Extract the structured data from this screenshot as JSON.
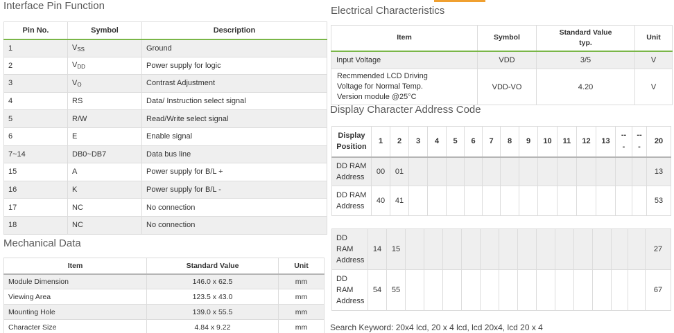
{
  "pin": {
    "title": "Interface Pin Function",
    "headers": [
      "Pin No.",
      "Symbol",
      "Description"
    ],
    "rows": [
      {
        "no": "1",
        "sym": "V",
        "sub": "SS",
        "desc": "Ground"
      },
      {
        "no": "2",
        "sym": "V",
        "sub": "DD",
        "desc": "Power supply for logic"
      },
      {
        "no": "3",
        "sym": "V",
        "sub": "O",
        "desc": "Contrast Adjustment"
      },
      {
        "no": "4",
        "sym": "RS",
        "sub": "",
        "desc": "Data/ Instruction  select signal"
      },
      {
        "no": "5",
        "sym": "R/W",
        "sub": "",
        "desc": "Read/Write select signal"
      },
      {
        "no": "6",
        "sym": "E",
        "sub": "",
        "desc": "Enable signal"
      },
      {
        "no": "7~14",
        "sym": "DB0~DB7",
        "sub": "",
        "desc": "Data bus line"
      },
      {
        "no": "15",
        "sym": "A",
        "sub": "",
        "desc": "Power supply for B/L +"
      },
      {
        "no": "16",
        "sym": "K",
        "sub": "",
        "desc": "Power supply for B/L -"
      },
      {
        "no": "17",
        "sym": "NC",
        "sub": "",
        "desc": "No connection"
      },
      {
        "no": "18",
        "sym": "NC",
        "sub": "",
        "desc": "No connection"
      }
    ]
  },
  "mech": {
    "title": "Mechanical Data",
    "headers": [
      "Item",
      "Standard Value",
      "Unit"
    ],
    "rows": [
      {
        "item": "Module Dimension",
        "value": "146.0 x 62.5",
        "unit": "mm"
      },
      {
        "item": "Viewing Area",
        "value": "123.5 x 43.0",
        "unit": "mm"
      },
      {
        "item": "Mounting Hole",
        "value": "139.0 x 55.5",
        "unit": "mm"
      },
      {
        "item": "Character Size",
        "value": "4.84 x 9.22",
        "unit": "mm"
      }
    ]
  },
  "elec": {
    "title": "Electrical Characteristics",
    "headers": {
      "item": "Item",
      "symbol": "Symbol",
      "std1": "Standard Value",
      "std2": "typ.",
      "unit": "Unit"
    },
    "rows": [
      {
        "item": [
          "Input Voltage"
        ],
        "symbol": "VDD",
        "value": "3/5",
        "unit": "V"
      },
      {
        "item": [
          "Recmmended LCD Driving",
          "Voltage for Normal Temp.",
          "Version module @25°C"
        ],
        "symbol": "VDD-VO",
        "value": "4.20",
        "unit": "V"
      }
    ]
  },
  "addr": {
    "title": "Display Character Address Code",
    "header_first": [
      "Display",
      "Position"
    ],
    "columns": [
      "1",
      "2",
      "3",
      "4",
      "5",
      "6",
      "7",
      "8",
      "9",
      "10",
      "11",
      "12",
      "13",
      "--\n-",
      "--\n-",
      "20"
    ],
    "rows1": [
      {
        "label": [
          "DD RAM",
          "Address"
        ],
        "c1": "00",
        "c2": "01",
        "last": "13"
      },
      {
        "label": [
          "DD RAM",
          "Address"
        ],
        "c1": "40",
        "c2": "41",
        "last": "53"
      }
    ],
    "rows2": [
      {
        "label": [
          "DD",
          "RAM",
          "Address"
        ],
        "c1": "14",
        "c2": "15",
        "last": "27"
      },
      {
        "label": [
          "DD",
          "RAM",
          "Address"
        ],
        "c1": "54",
        "c2": "55",
        "last": "67"
      }
    ]
  },
  "search_text": "Search Keyword: 20x4 lcd, 20 x 4 lcd, lcd 20x4, lcd 20 x 4",
  "colors": {
    "accent_green": "#7ab648",
    "row_alt": "#efefef",
    "border": "#dcdcdc",
    "top_orange": "#f0a030"
  }
}
